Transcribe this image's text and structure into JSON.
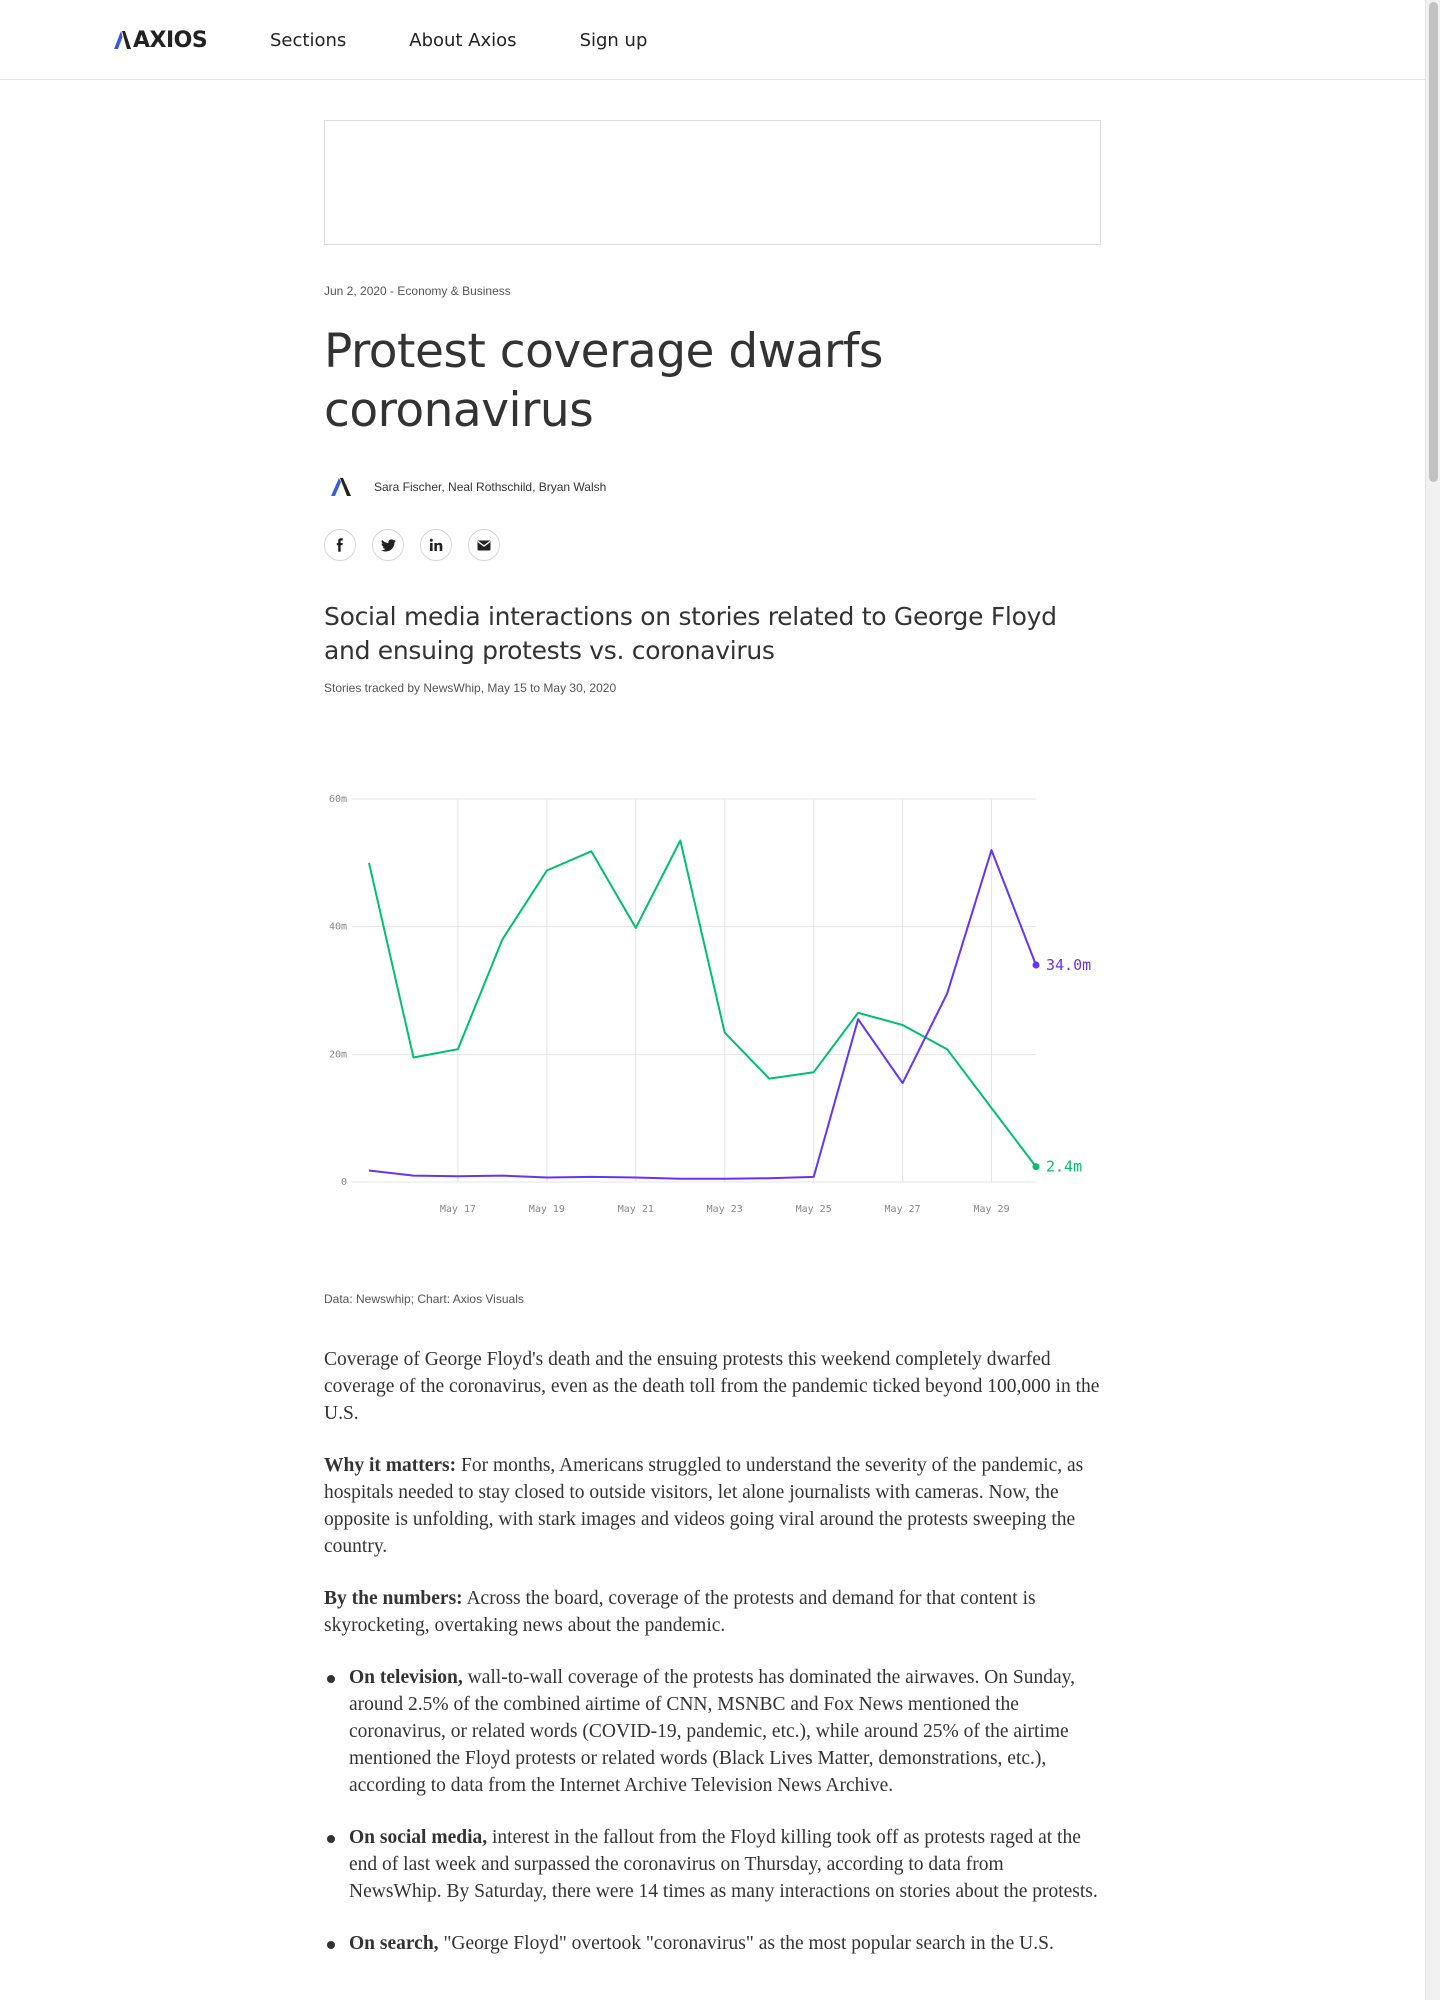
{
  "header": {
    "logo_text": "AXIOS",
    "nav": [
      "Sections",
      "About Axios",
      "Sign up"
    ]
  },
  "article": {
    "date": "Jun 2, 2020",
    "separator": " - ",
    "category": "Economy & Business",
    "headline": "Protest coverage dwarfs coronavirus",
    "authors": "Sara Fischer, Neal Rothschild, Bryan Walsh",
    "share_icons": [
      "facebook-icon",
      "twitter-icon",
      "linkedin-icon",
      "email-icon"
    ],
    "chart_title": "Social media interactions on stories related to George Floyd and ensuing protests vs. coronavirus",
    "chart_subtitle": "Stories tracked by NewsWhip, May 15 to May 30, 2020",
    "chart_source": "Data: Newswhip; Chart: Axios Visuals",
    "paragraphs": [
      {
        "lead": "",
        "text": "Coverage of George Floyd's death and the ensuing protests this weekend completely dwarfed coverage of the coronavirus, even as the death toll from the pandemic ticked beyond 100,000 in the U.S."
      },
      {
        "lead": "Why it matters:",
        "text": " For months, Americans struggled to understand the severity of the pandemic, as hospitals needed to stay closed to outside visitors, let alone journalists with cameras. Now, the opposite is unfolding, with stark images and videos going viral around the protests sweeping the country."
      },
      {
        "lead": "By the numbers:",
        "text": " Across the board, coverage of the protests and demand for that content is skyrocketing, overtaking news about the pandemic."
      }
    ],
    "bullets": [
      {
        "lead": "On television,",
        "text": " wall-to-wall coverage of the protests has dominated the airwaves. On Sunday, around 2.5% of the combined airtime of CNN, MSNBC and Fox News mentioned the coronavirus, or related words (COVID-19, pandemic, etc.), while around 25% of the airtime mentioned the Floyd protests or related words (Black Lives Matter, demonstrations, etc.), according to data from the Internet Archive Television News Archive."
      },
      {
        "lead": "On social media,",
        "text": " interest in the fallout from the Floyd killing took off as protests raged at the end of last week and surpassed the coronavirus on Thursday, according to data from NewsWhip. By Saturday, there were 14 times as many interactions on stories about the protests."
      },
      {
        "lead": "On search,",
        "text": " \"George Floyd\" overtook \"coronavirus\" as the most popular search in the U.S."
      }
    ]
  },
  "chart_data": {
    "type": "line",
    "x": [
      "May 15",
      "May 16",
      "May 17",
      "May 18",
      "May 19",
      "May 20",
      "May 21",
      "May 22",
      "May 23",
      "May 24",
      "May 25",
      "May 26",
      "May 27",
      "May 28",
      "May 29",
      "May 30"
    ],
    "x_tick_labels": [
      "May 17",
      "May 19",
      "May 21",
      "May 23",
      "May 25",
      "May 27",
      "May 29"
    ],
    "y_tick_labels": [
      "60m",
      "40m",
      "20m",
      "0"
    ],
    "ylim": [
      0,
      60
    ],
    "grid": true,
    "series": [
      {
        "values": [
          50,
          19.5,
          20.8,
          38,
          48.8,
          51.8,
          39.8,
          53.5,
          23.4,
          16.2,
          17.2,
          26.5,
          24.6,
          20.8,
          11.6,
          2.4
        ],
        "color": "#00bf6f",
        "end_label": "2.4m"
      },
      {
        "values": [
          1.8,
          1.0,
          0.9,
          1.0,
          0.7,
          0.8,
          0.7,
          0.5,
          0.5,
          0.6,
          0.8,
          25.5,
          15.5,
          29.5,
          52.0,
          34.0
        ],
        "color": "#6533ff",
        "end_label": "34.0m"
      }
    ]
  },
  "colors": {
    "logo_accent": "#3a5bd9",
    "green": "#00bf6f",
    "purple": "#6533ff"
  }
}
